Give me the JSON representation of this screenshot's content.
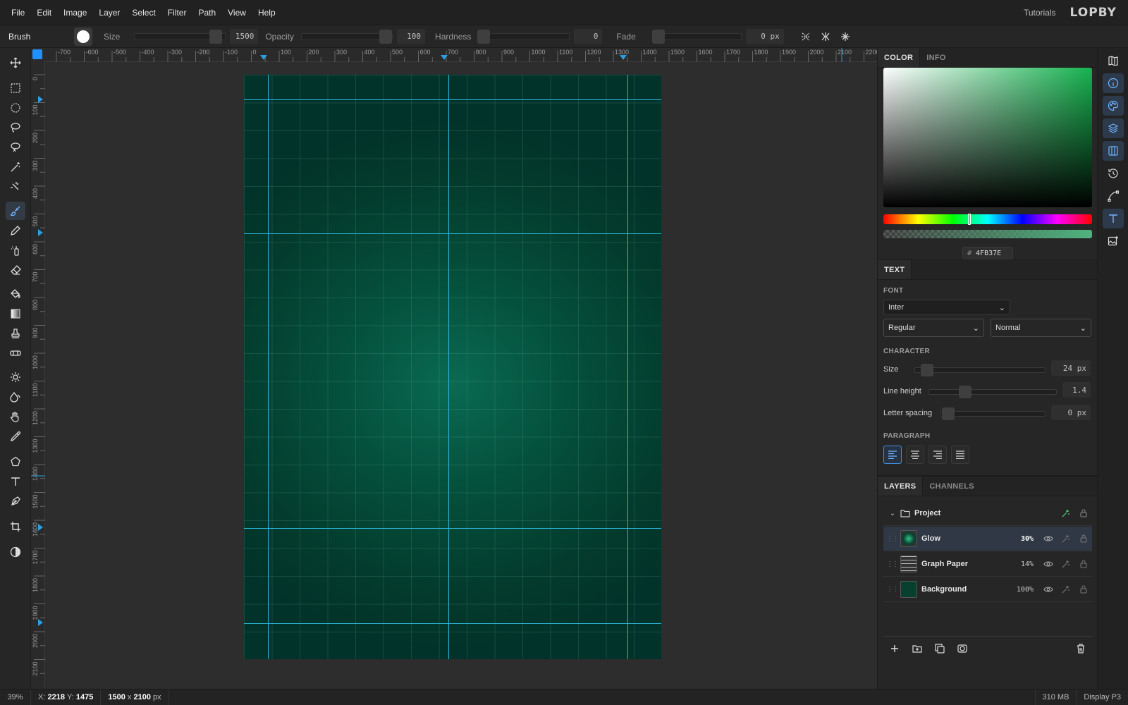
{
  "menu": [
    "File",
    "Edit",
    "Image",
    "Layer",
    "Select",
    "Filter",
    "Path",
    "View",
    "Help"
  ],
  "header": {
    "tutorials": "Tutorials",
    "logo": "LOPBY"
  },
  "options": {
    "tool": "Brush",
    "size_label": "Size",
    "size_value": "1500",
    "opacity_label": "Opacity",
    "opacity_value": "100",
    "hardness_label": "Hardness",
    "hardness_value": "0",
    "fade_label": "Fade",
    "fade_value": "0 px"
  },
  "rulers": {
    "h": [
      "-700",
      "-600",
      "-500",
      "-400",
      "-300",
      "-200",
      "-100",
      "0",
      "100",
      "200",
      "300",
      "400",
      "500",
      "600",
      "700",
      "800",
      "900",
      "1000",
      "1100",
      "1200",
      "1300",
      "1400",
      "1500",
      "1600",
      "1700",
      "1800",
      "1900",
      "2000",
      "2100",
      "2200"
    ],
    "v": [
      "0",
      "100",
      "200",
      "300",
      "400",
      "500",
      "600",
      "700",
      "800",
      "900",
      "1000",
      "1100",
      "1200",
      "1300",
      "1400",
      "1500",
      "1600",
      "1700",
      "1800",
      "1900",
      "2000",
      "2100"
    ]
  },
  "status": {
    "zoom": "39%",
    "x_label": "X:",
    "x": "2218",
    "y_label": "Y:",
    "y": "1475",
    "dims_w": "1500",
    "dims_sep": "x",
    "dims_h": "2100",
    "dims_unit": "px",
    "memory": "310 MB",
    "profile": "Display P3"
  },
  "color_panel": {
    "tab_color": "COLOR",
    "tab_info": "INFO",
    "hash": "#",
    "hex": "4FB37E",
    "accent": "#4FB37E"
  },
  "text_panel": {
    "tab": "TEXT",
    "font_title": "FONT",
    "font": "Inter",
    "weight": "Regular",
    "style": "Normal",
    "character_title": "CHARACTER",
    "size_label": "Size",
    "size_value": "24 px",
    "line_height_label": "Line height",
    "line_height_value": "1.4",
    "letter_spacing_label": "Letter spacing",
    "letter_spacing_value": "0 px",
    "paragraph_title": "PARAGRAPH"
  },
  "layers_panel": {
    "tab_layers": "LAYERS",
    "tab_channels": "CHANNELS",
    "group": "Project",
    "items": [
      {
        "name": "Glow",
        "opacity": "30%",
        "selected": true
      },
      {
        "name": "Graph Paper",
        "opacity": "14%",
        "selected": false
      },
      {
        "name": "Background",
        "opacity": "100%",
        "selected": false
      }
    ]
  }
}
